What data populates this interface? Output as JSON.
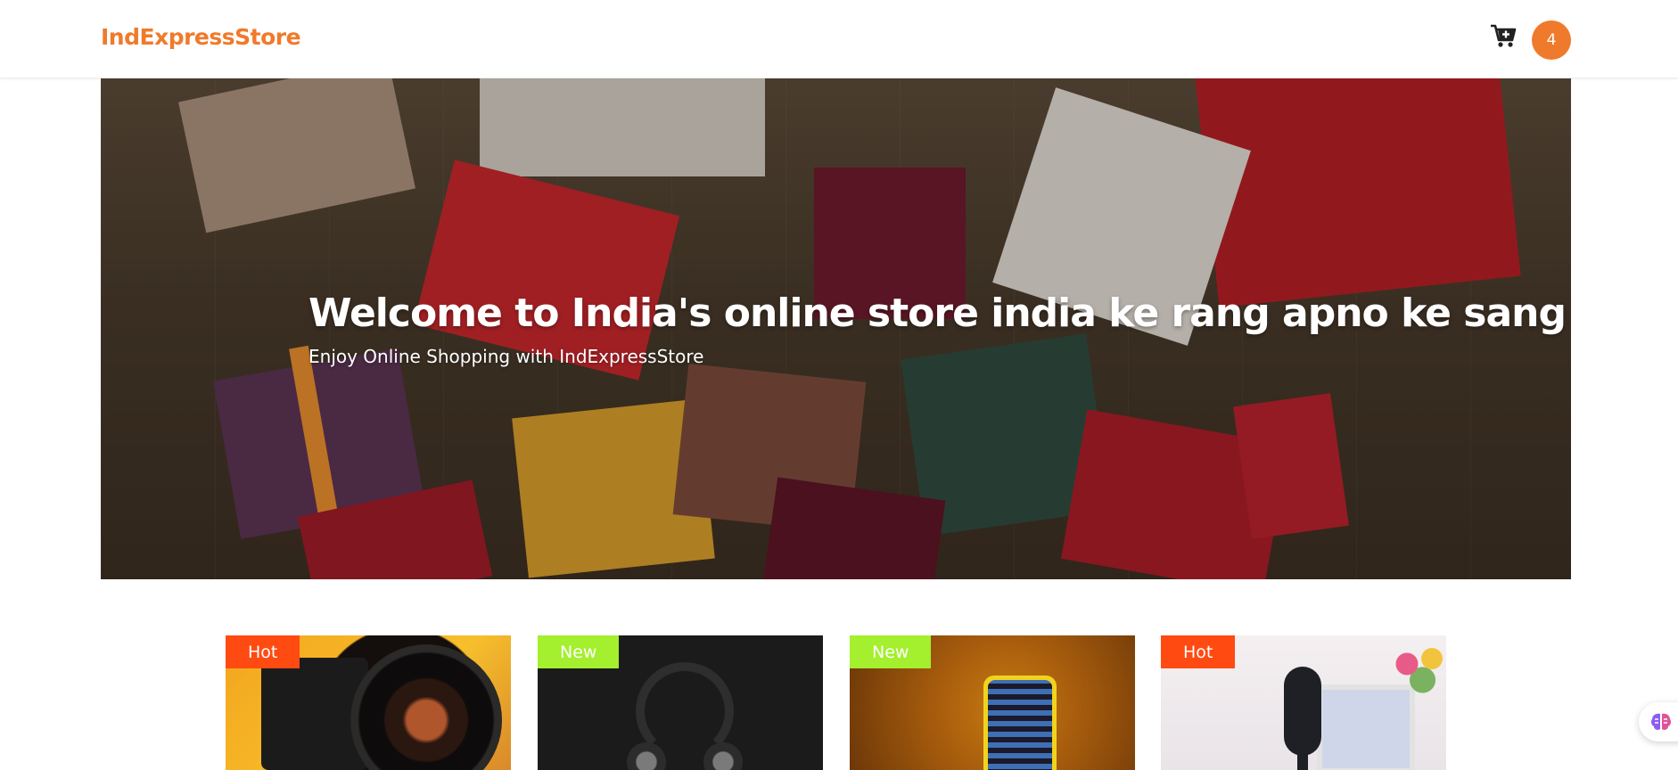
{
  "header": {
    "brand": "IndExpressStore",
    "cart_icon": "cart-plus-icon",
    "cart_count": "4"
  },
  "hero": {
    "title": "Welcome to India's online store india ke rang apno ke sang",
    "subtitle": "Enjoy Online Shopping with IndExpressStore"
  },
  "products": [
    {
      "tag": "Hot",
      "image": "camera-lens"
    },
    {
      "tag": "New",
      "image": "headphones"
    },
    {
      "tag": "New",
      "image": "smartphone"
    },
    {
      "tag": "Hot",
      "image": "studio-microphone"
    }
  ],
  "colors": {
    "brand": "#f07a2b",
    "tag_hot": "#ff4a12",
    "tag_new": "#a4ef2e"
  },
  "widget": {
    "icon": "brain-icon"
  }
}
